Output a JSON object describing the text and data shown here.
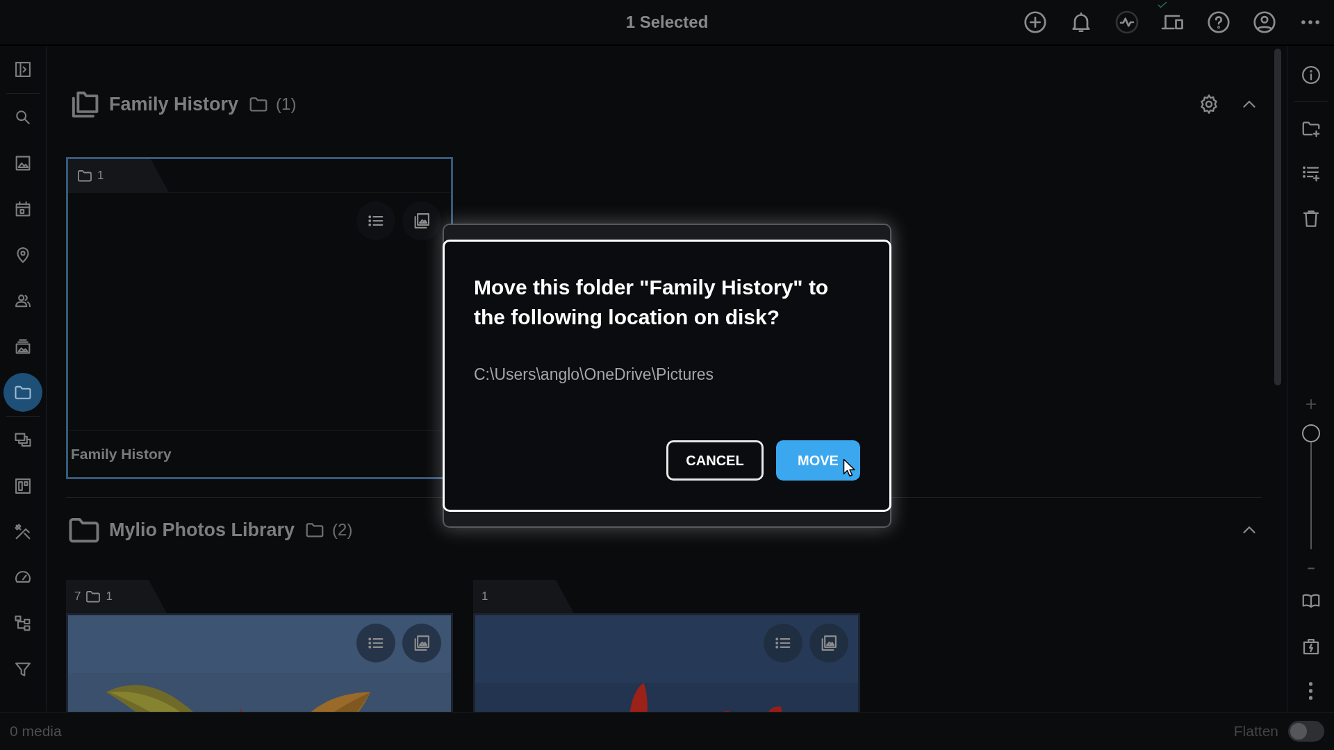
{
  "top_bar": {
    "title": "1 Selected"
  },
  "left_sidebar": {
    "items": [
      {
        "selected": false
      },
      {
        "selected": false
      },
      {
        "selected": false
      },
      {
        "selected": false
      },
      {
        "selected": false
      },
      {
        "selected": false
      },
      {
        "selected": false
      },
      {
        "selected": true
      },
      {
        "selected": false
      },
      {
        "selected": false
      },
      {
        "selected": false
      },
      {
        "selected": false
      },
      {
        "selected": false
      },
      {
        "selected": false
      }
    ]
  },
  "sections": [
    {
      "kind": "collection",
      "title": "Family History",
      "count": "(1)",
      "settings": true,
      "expanded": true,
      "folders": [
        {
          "kind": "empty",
          "selected": true,
          "folder_count": "1",
          "name": "Family History"
        }
      ]
    },
    {
      "kind": "folder",
      "title": "Mylio Photos Library",
      "count": "(2)",
      "settings": false,
      "expanded": true,
      "folders": [
        {
          "kind": "leaves",
          "selected": false,
          "media_count": "7",
          "folder_count": "1"
        },
        {
          "kind": "flowers",
          "selected": false,
          "media_count": "1"
        }
      ]
    }
  ],
  "right_sidebar": {
    "zoom": {
      "level": 1
    }
  },
  "dialog": {
    "title": "Move this folder \"Family History\" to the following location on disk?",
    "path": "C:\\Users\\anglo\\OneDrive\\Pictures",
    "buttons": [
      {
        "label": "CANCEL",
        "kind": "secondary"
      },
      {
        "label": "MOVE",
        "kind": "primary"
      }
    ]
  },
  "status_bar": {
    "media": "0 media",
    "flatten": {
      "label": "Flatten",
      "on": false
    }
  }
}
